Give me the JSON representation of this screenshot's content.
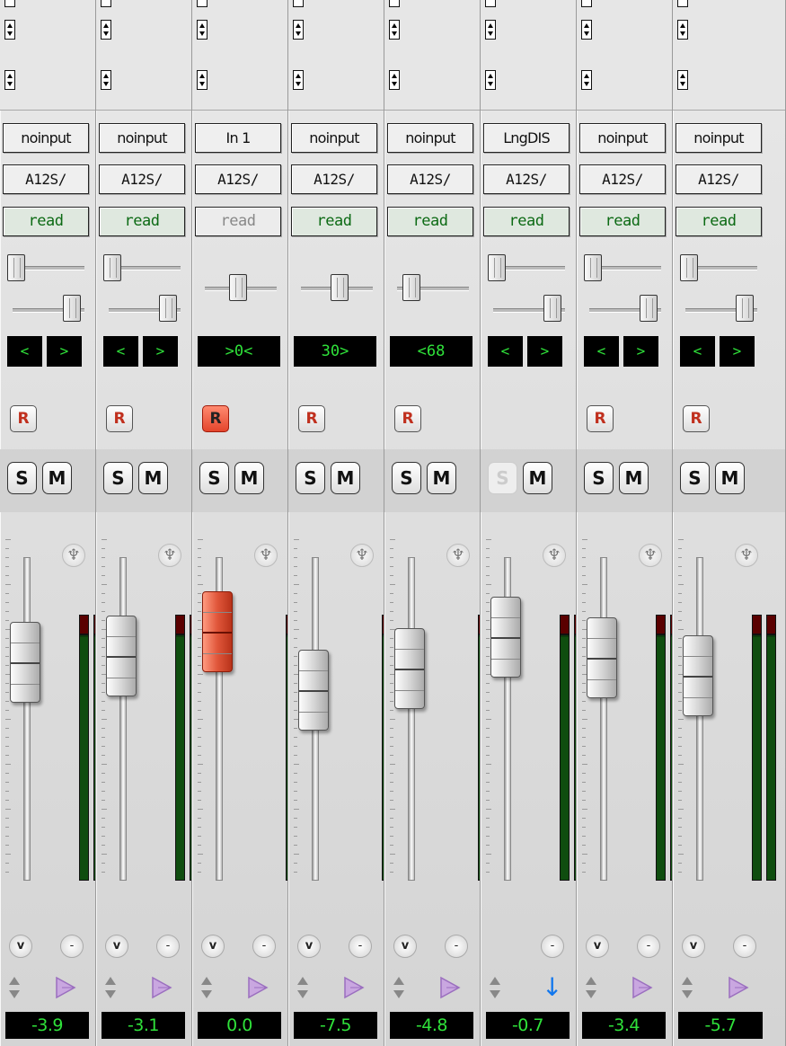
{
  "colors": {
    "meter_green": "#0f4d0f",
    "meter_peak": "#5a0000",
    "readout_text": "#2fe23a",
    "record_armed": "#e4452c",
    "automation_text": "#0c6a14"
  },
  "icons": {
    "voice": "voice-icon",
    "direct_out": "down-arrow-icon",
    "pin": "pin-icon",
    "updown": "updown-arrows-icon"
  },
  "strips": [
    {
      "input": "noinput",
      "output": "A12S/",
      "automation": "read",
      "automation_dim": false,
      "pan": {
        "left": "<",
        "right": ">"
      },
      "rec": "R",
      "rec_armed": false,
      "rec_visible": true,
      "solo": "S",
      "solo_disabled": false,
      "mute": "M",
      "fader_level_db": -3.9,
      "meter_count": 2,
      "v_button": "v",
      "dash_button": "-",
      "route_icon": "voice",
      "volume": "-3.9"
    },
    {
      "input": "noinput",
      "output": "A12S/",
      "automation": "read",
      "automation_dim": false,
      "pan": {
        "left": "<",
        "right": ">"
      },
      "rec": "R",
      "rec_armed": false,
      "rec_visible": true,
      "solo": "S",
      "solo_disabled": false,
      "mute": "M",
      "fader_level_db": -3.1,
      "meter_count": 2,
      "v_button": "v",
      "dash_button": "-",
      "route_icon": "voice",
      "volume": "-3.1"
    },
    {
      "input": "In 1",
      "output": "A12S/",
      "automation": "read",
      "automation_dim": true,
      "pan": {
        "single": ">0<"
      },
      "rec": "R",
      "rec_armed": true,
      "rec_visible": true,
      "solo": "S",
      "solo_disabled": false,
      "mute": "M",
      "fader_level_db": 0.0,
      "meter_count": 1,
      "v_button": "v",
      "dash_button": "-",
      "route_icon": "voice",
      "volume": "0.0"
    },
    {
      "input": "noinput",
      "output": "A12S/",
      "automation": "read",
      "automation_dim": false,
      "pan": {
        "single": "30>"
      },
      "rec": "R",
      "rec_armed": false,
      "rec_visible": true,
      "solo": "S",
      "solo_disabled": false,
      "mute": "M",
      "fader_level_db": -7.5,
      "meter_count": 1,
      "v_button": "v",
      "dash_button": "-",
      "route_icon": "voice",
      "volume": "-7.5"
    },
    {
      "input": "noinput",
      "output": "A12S/",
      "automation": "read",
      "automation_dim": false,
      "pan": {
        "single": "<68"
      },
      "rec": "R",
      "rec_armed": false,
      "rec_visible": true,
      "solo": "S",
      "solo_disabled": false,
      "mute": "M",
      "fader_level_db": -4.8,
      "meter_count": 1,
      "v_button": "v",
      "dash_button": "-",
      "route_icon": "voice",
      "volume": "-4.8"
    },
    {
      "input": "LngDIS",
      "output": "A12S/",
      "automation": "read",
      "automation_dim": false,
      "pan": {
        "left": "<",
        "right": ">"
      },
      "rec": "",
      "rec_armed": false,
      "rec_visible": false,
      "solo": "S",
      "solo_disabled": true,
      "mute": "M",
      "fader_level_db": -0.7,
      "meter_count": 2,
      "v_button": "",
      "dash_button": "-",
      "route_icon": "arrow",
      "volume": "-0.7"
    },
    {
      "input": "noinput",
      "output": "A12S/",
      "automation": "read",
      "automation_dim": false,
      "pan": {
        "left": "<",
        "right": ">"
      },
      "rec": "R",
      "rec_armed": false,
      "rec_visible": true,
      "solo": "S",
      "solo_disabled": false,
      "mute": "M",
      "fader_level_db": -3.4,
      "meter_count": 2,
      "v_button": "v",
      "dash_button": "-",
      "route_icon": "voice",
      "volume": "-3.4"
    },
    {
      "input": "noinput",
      "output": "A12S/",
      "automation": "read",
      "automation_dim": false,
      "pan": {
        "left": "<",
        "right": ">"
      },
      "rec": "R",
      "rec_armed": false,
      "rec_visible": true,
      "solo": "S",
      "solo_disabled": false,
      "mute": "M",
      "fader_level_db": -5.7,
      "meter_count": 2,
      "v_button": "v",
      "dash_button": "-",
      "route_icon": "voice",
      "volume": "-5.7"
    }
  ]
}
